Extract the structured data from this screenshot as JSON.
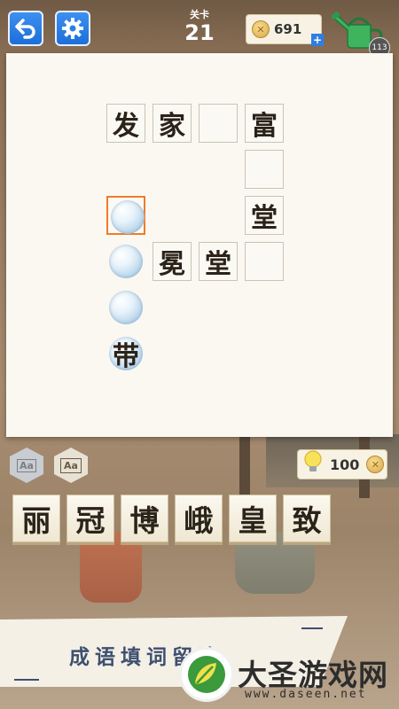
{
  "topbar": {
    "back_icon": "back-arrow-icon",
    "settings_icon": "gear-icon",
    "level_label": "关卡",
    "level_number": "21",
    "coins": "691",
    "coins_plus": "+",
    "watering_can_icon": "watering-can-icon",
    "watering_count": "113"
  },
  "board": {
    "cells": [
      {
        "row": 0,
        "col": 0,
        "char": "发"
      },
      {
        "row": 0,
        "col": 1,
        "char": "家"
      },
      {
        "row": 0,
        "col": 2,
        "char": ""
      },
      {
        "row": 0,
        "col": 3,
        "char": "富"
      },
      {
        "row": 1,
        "col": 3,
        "char": ""
      },
      {
        "row": 2,
        "col": 3,
        "char": "堂"
      },
      {
        "row": 2,
        "col": 0,
        "char": "",
        "bubble": true,
        "selected": true
      },
      {
        "row": 3,
        "col": 0,
        "char": "",
        "bubble": true
      },
      {
        "row": 3,
        "col": 1,
        "char": "冕"
      },
      {
        "row": 3,
        "col": 2,
        "char": "堂"
      },
      {
        "row": 3,
        "col": 3,
        "char": ""
      },
      {
        "row": 4,
        "col": 0,
        "char": "",
        "bubble": true
      },
      {
        "row": 5,
        "col": 0,
        "char": "带",
        "bubble": true
      }
    ]
  },
  "tools": {
    "font_small_label": "Aa",
    "font_large_label": "Aa",
    "hint_icon": "lightbulb-icon",
    "hint_cost": "100"
  },
  "candidates": [
    "丽",
    "冠",
    "博",
    "峨",
    "皇",
    "致"
  ],
  "footer": {
    "banner_text": "成语填词留迹",
    "watermark_name": "大圣游戏网",
    "watermark_url": "www.daseen.net"
  },
  "colors": {
    "button_blue": "#1d6fd8",
    "selection_orange": "#f07b2a",
    "ink": "#2b2219"
  }
}
